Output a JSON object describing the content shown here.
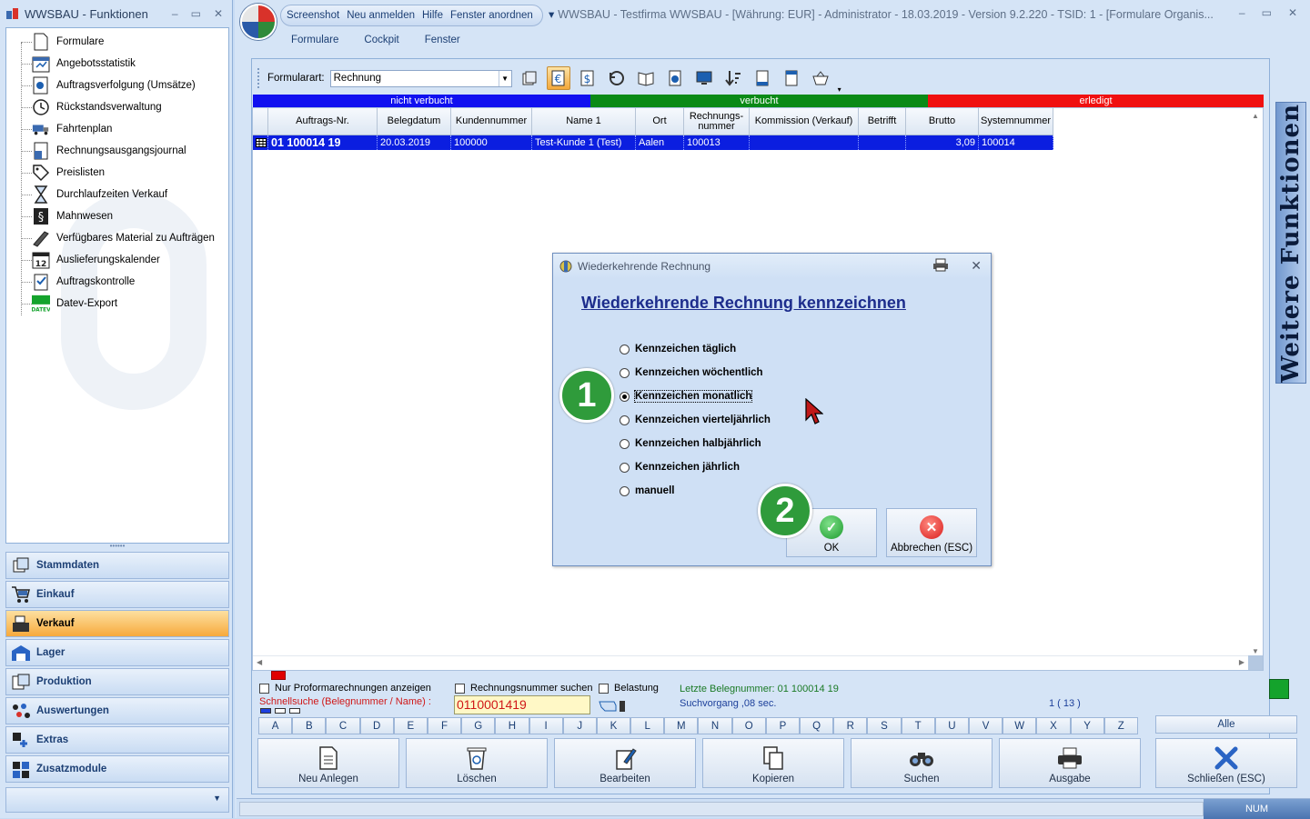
{
  "left_window": {
    "title": "WWSBAU - Funktionen",
    "tree_items": [
      {
        "label": "Formulare",
        "icon": "document-icon"
      },
      {
        "label": "Angebotsstatistik",
        "icon": "calendar-icon"
      },
      {
        "label": "Auftragsverfolgung (Umsätze)",
        "icon": "chart-icon"
      },
      {
        "label": "Rückstandsverwaltung",
        "icon": "clock-icon"
      },
      {
        "label": "Fahrtenplan",
        "icon": "truck-icon"
      },
      {
        "label": "Rechnungsausgangsjournal",
        "icon": "journal-icon"
      },
      {
        "label": "Preislisten",
        "icon": "tag-icon"
      },
      {
        "label": "Durchlaufzeiten Verkauf",
        "icon": "hourglass-icon"
      },
      {
        "label": "Mahnwesen",
        "icon": "paragraph-icon"
      },
      {
        "label": "Verfügbares Material zu Aufträgen",
        "icon": "wrench-icon"
      },
      {
        "label": "Auslieferungskalender",
        "icon": "calendar-12-icon"
      },
      {
        "label": "Auftragskontrolle",
        "icon": "checklist-icon"
      },
      {
        "label": "Datev-Export",
        "icon": "datev-icon"
      }
    ],
    "datev_caption": "DATEV",
    "calendar_day": "12",
    "nav": [
      {
        "label": "Stammdaten",
        "icon": "master-data-icon",
        "active": false
      },
      {
        "label": "Einkauf",
        "icon": "cart-icon",
        "active": false
      },
      {
        "label": "Verkauf",
        "icon": "cash-register-icon",
        "active": true
      },
      {
        "label": "Lager",
        "icon": "warehouse-icon",
        "active": false
      },
      {
        "label": "Produktion",
        "icon": "production-icon",
        "active": false
      },
      {
        "label": "Auswertungen",
        "icon": "analysis-icon",
        "active": false
      },
      {
        "label": "Extras",
        "icon": "extras-icon",
        "active": false
      },
      {
        "label": "Zusatzmodule",
        "icon": "modules-icon",
        "active": false
      }
    ]
  },
  "main_window": {
    "qat": [
      "Screenshot",
      "Neu anmelden",
      "Hilfe",
      "Fenster anordnen"
    ],
    "title": "WWSBAU - Testfirma WWSBAU - [Währung: EUR] - Administrator - 18.03.2019 - Version 9.2.220 - TSID: 1  - [Formulare Organis...",
    "ribbon_tabs": [
      "Formulare",
      "Cockpit",
      "Fenster"
    ],
    "formularart_label": "Formularart:",
    "formularart_value": "Rechnung",
    "status_bands": [
      {
        "label": "nicht verbucht",
        "color": "#1010f0"
      },
      {
        "label": "verbucht",
        "color": "#0a8a16"
      },
      {
        "label": "erledigt",
        "color": "#f01010"
      }
    ],
    "columns": [
      "Auftrags-Nr.",
      "Belegdatum",
      "Kundennummer",
      "Name 1",
      "Ort",
      "Rechnungs-\nnummer",
      "Kommission (Verkauf)",
      "Betrifft",
      "Brutto",
      "Systemnummer"
    ],
    "rows": [
      [
        "01 100014 19",
        "20.03.2019",
        "100000",
        "Test-Kunde 1  (Test)",
        "Aalen",
        "100013",
        "",
        "",
        "3,09",
        "100014"
      ]
    ],
    "proforma_label": "Nur Proformarechnungen anzeigen",
    "rechnungsnr_label": "Rechnungsnummer suchen",
    "belastung_label": "Belastung",
    "schnellsuche_label": "Schnellsuche (Belegnummer / Name) :",
    "schnellsuche_value": "0110001419",
    "letzte_belegnummer": "Letzte Belegnummer: 01 100014 19",
    "suchvorgang": "Suchvorgang ,08 sec.",
    "count": "1  ( 13 )",
    "letters": [
      "A",
      "B",
      "C",
      "D",
      "E",
      "F",
      "G",
      "H",
      "I",
      "J",
      "K",
      "L",
      "M",
      "N",
      "O",
      "P",
      "Q",
      "R",
      "S",
      "T",
      "U",
      "V",
      "W",
      "X",
      "Y",
      "Z"
    ],
    "alle_label": "Alle",
    "actions": [
      {
        "label": "Neu Anlegen",
        "icon": "new-document-icon"
      },
      {
        "label": "Löschen",
        "icon": "trash-icon"
      },
      {
        "label": "Bearbeiten",
        "icon": "edit-icon"
      },
      {
        "label": "Kopieren",
        "icon": "copy-icon"
      },
      {
        "label": "Suchen",
        "icon": "binoculars-icon"
      },
      {
        "label": "Ausgabe",
        "icon": "printer-icon"
      },
      {
        "label": "Schließen (ESC)",
        "icon": "close-x-icon"
      }
    ],
    "num_indicator": "NUM"
  },
  "sidebar_label": "Weitere Funktionen",
  "dialog": {
    "title": "Wiederkehrende Rechnung",
    "heading": "Wiederkehrende Rechnung kennzeichnen",
    "options": [
      {
        "label": "Kennzeichen täglich",
        "selected": false
      },
      {
        "label": "Kennzeichen wöchentlich",
        "selected": false
      },
      {
        "label": "Kennzeichen monatlich",
        "selected": true
      },
      {
        "label": "Kennzeichen vierteljährlich",
        "selected": false
      },
      {
        "label": "Kennzeichen halbjährlich",
        "selected": false
      },
      {
        "label": "Kennzeichen jährlich",
        "selected": false
      },
      {
        "label": "manuell",
        "selected": false
      }
    ],
    "ok_label": "OK",
    "cancel_label": "Abbrechen (ESC)"
  },
  "markers": [
    "1",
    "2"
  ],
  "window_controls": {
    "minimize": "–",
    "maximize": "▭",
    "close": "✕"
  }
}
